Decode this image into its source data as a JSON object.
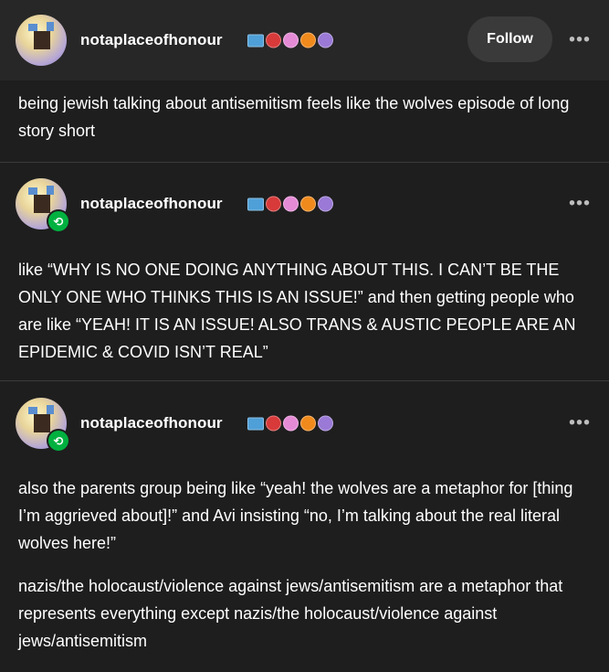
{
  "original_post": {
    "username": "notaplaceofhonour",
    "follow_label": "Follow",
    "more_label": "•••",
    "text": "being jewish talking about antisemitism feels like the wolves episode of long story short"
  },
  "reblogs": [
    {
      "username": "notaplaceofhonour",
      "more_label": "•••",
      "paragraphs": [
        "like “WHY IS NO ONE DOING ANYTHING ABOUT THIS. I CAN’T BE THE ONLY ONE WHO THINKS THIS IS AN ISSUE!” and then getting people who are like “YEAH! IT IS AN ISSUE! ALSO TRANS & AUSTIC PEOPLE ARE AN EPIDEMIC & COVID ISN’T REAL”"
      ]
    },
    {
      "username": "notaplaceofhonour",
      "more_label": "•••",
      "paragraphs": [
        "also the parents group being like “yeah! the wolves are a metaphor for [thing I’m aggrieved about]!” and Avi insisting “no, I’m talking about the real literal wolves here!”",
        "nazis/the holocaust/violence against jews/antisemitism are a metaphor that represents everything except nazis/the holocaust/violence against jews/antisemitism"
      ]
    }
  ],
  "badge_icons": [
    "flag-badge-icon",
    "red-shield-badge-icon",
    "pink-badge-icon",
    "orange-badge-icon",
    "purple-badge-icon"
  ],
  "colors": {
    "background": "#1e1e1e",
    "header_background": "#272727",
    "follow_button": "#3a3a3a",
    "reblog_badge": "#00b140"
  }
}
